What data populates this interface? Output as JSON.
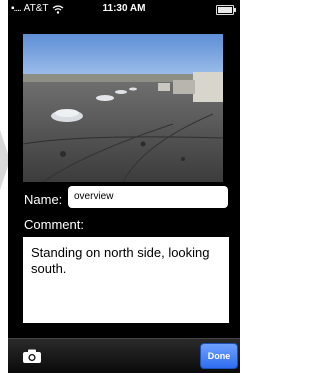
{
  "status_bar": {
    "carrier": "AT&T",
    "time": "11:30 AM",
    "signal_icon": "signal-dots-icon",
    "wifi_icon": "wifi-icon",
    "battery_icon": "battery-icon"
  },
  "photo": {
    "description_icon": "rooftop-photo"
  },
  "form": {
    "name_label": "Name:",
    "name_value": "overview",
    "comment_label": "Comment:",
    "comment_value": "Standing on north side, looking south."
  },
  "toolbar": {
    "camera_icon": "camera-icon",
    "done_label": "Done"
  },
  "colors": {
    "toolbar_bg": "#1a1a1a",
    "done_button": "#3a78f2"
  }
}
